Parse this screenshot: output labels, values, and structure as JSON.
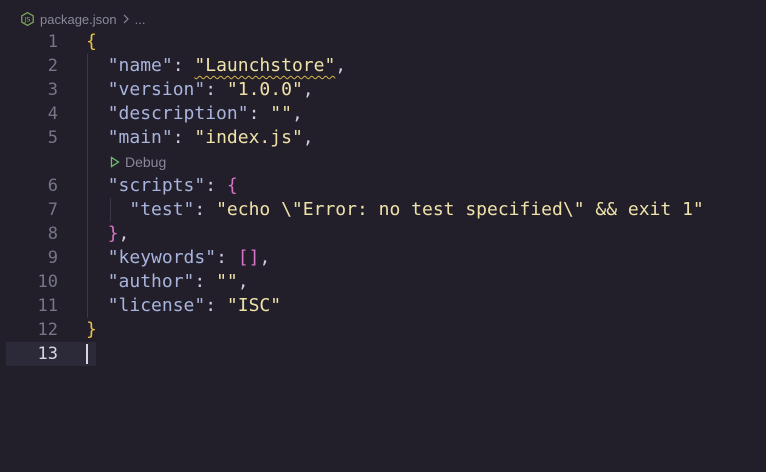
{
  "breadcrumb": {
    "file_name": "package.json",
    "more": "..."
  },
  "codelens": {
    "label": "Debug"
  },
  "lines": [
    {
      "number": "1",
      "tokens": [
        {
          "t": "{",
          "c": "brace"
        }
      ]
    },
    {
      "number": "2",
      "tokens": [
        {
          "t": "  ",
          "c": "punct"
        },
        {
          "t": "\"name\"",
          "c": "key"
        },
        {
          "t": ": ",
          "c": "punct"
        },
        {
          "t": "\"Launchstore\"",
          "c": "str squiggle"
        },
        {
          "t": ",",
          "c": "punct"
        }
      ]
    },
    {
      "number": "3",
      "tokens": [
        {
          "t": "  ",
          "c": "punct"
        },
        {
          "t": "\"version\"",
          "c": "key"
        },
        {
          "t": ": ",
          "c": "punct"
        },
        {
          "t": "\"1.0.0\"",
          "c": "str"
        },
        {
          "t": ",",
          "c": "punct"
        }
      ]
    },
    {
      "number": "4",
      "tokens": [
        {
          "t": "  ",
          "c": "punct"
        },
        {
          "t": "\"description\"",
          "c": "key"
        },
        {
          "t": ": ",
          "c": "punct"
        },
        {
          "t": "\"\"",
          "c": "str"
        },
        {
          "t": ",",
          "c": "punct"
        }
      ]
    },
    {
      "number": "5",
      "tokens": [
        {
          "t": "  ",
          "c": "punct"
        },
        {
          "t": "\"main\"",
          "c": "key"
        },
        {
          "t": ": ",
          "c": "punct"
        },
        {
          "t": "\"index.js\"",
          "c": "str"
        },
        {
          "t": ",",
          "c": "punct"
        }
      ]
    },
    {
      "number": "6",
      "tokens": [
        {
          "t": "  ",
          "c": "punct"
        },
        {
          "t": "\"scripts\"",
          "c": "key"
        },
        {
          "t": ": ",
          "c": "punct"
        },
        {
          "t": "{",
          "c": "bracket2"
        }
      ]
    },
    {
      "number": "7",
      "tokens": [
        {
          "t": "    ",
          "c": "punct"
        },
        {
          "t": "\"test\"",
          "c": "key"
        },
        {
          "t": ": ",
          "c": "punct"
        },
        {
          "t": "\"echo \\\"Error: no test specified\\\" && exit 1\"",
          "c": "str"
        }
      ]
    },
    {
      "number": "8",
      "tokens": [
        {
          "t": "  ",
          "c": "punct"
        },
        {
          "t": "}",
          "c": "bracket2"
        },
        {
          "t": ",",
          "c": "punct"
        }
      ]
    },
    {
      "number": "9",
      "tokens": [
        {
          "t": "  ",
          "c": "punct"
        },
        {
          "t": "\"keywords\"",
          "c": "key"
        },
        {
          "t": ": ",
          "c": "punct"
        },
        {
          "t": "[]",
          "c": "bracket2"
        },
        {
          "t": ",",
          "c": "punct"
        }
      ]
    },
    {
      "number": "10",
      "tokens": [
        {
          "t": "  ",
          "c": "punct"
        },
        {
          "t": "\"author\"",
          "c": "key"
        },
        {
          "t": ": ",
          "c": "punct"
        },
        {
          "t": "\"\"",
          "c": "str"
        },
        {
          "t": ",",
          "c": "punct"
        }
      ]
    },
    {
      "number": "11",
      "tokens": [
        {
          "t": "  ",
          "c": "punct"
        },
        {
          "t": "\"license\"",
          "c": "key"
        },
        {
          "t": ": ",
          "c": "punct"
        },
        {
          "t": "\"ISC\"",
          "c": "str"
        }
      ]
    },
    {
      "number": "12",
      "tokens": [
        {
          "t": "}",
          "c": "brace"
        }
      ]
    },
    {
      "number": "13",
      "tokens": []
    }
  ],
  "current_line": "13",
  "colors": {
    "background": "#221f2b",
    "brace": "#e8c34a",
    "key": "#a8b4dc",
    "string": "#efe2a8",
    "nested_bracket": "#d673c6"
  }
}
